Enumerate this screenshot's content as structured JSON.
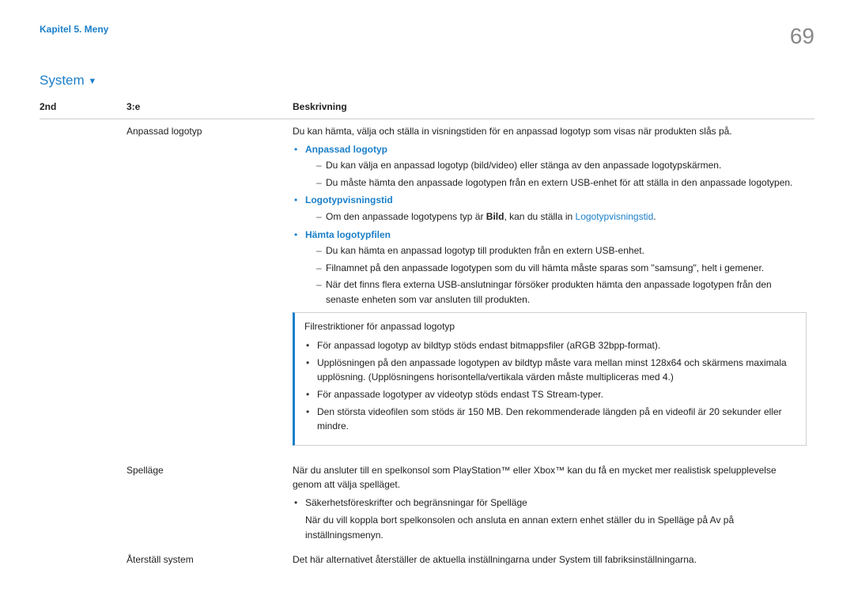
{
  "header": {
    "chapter": "Kapitel 5. Meny",
    "page_number": "69"
  },
  "section": {
    "title": "System",
    "triangle": "▼"
  },
  "columns": {
    "c1": "2nd",
    "c2": "3:e",
    "c3": "Beskrivning"
  },
  "rows": {
    "custom_logo": {
      "name": "Anpassad logotyp",
      "desc_intro": "Du kan hämta, välja och ställa in visningstiden för en anpassad logotyp som visas när produkten slås på.",
      "items": {
        "anpassad_logotyp": {
          "label": "Anpassad logotyp",
          "d1": "Du kan välja en anpassad logotyp (bild/video) eller stänga av den anpassade logotypskärmen.",
          "d2": "Du måste hämta den anpassade logotypen från en extern USB-enhet för att ställa in den anpassade logotypen."
        },
        "logotypvisningstid": {
          "label": "Logotypvisningstid",
          "d1_pre": "Om den anpassade logotypens typ är ",
          "d1_bold": "Bild",
          "d1_mid": ", kan du ställa in ",
          "d1_link": "Logotypvisningstid",
          "d1_post": "."
        },
        "hamta": {
          "label": "Hämta logotypfilen",
          "d1": "Du kan hämta en anpassad logotyp till produkten från en extern USB-enhet.",
          "d2": "Filnamnet på den anpassade logotypen som du vill hämta måste sparas som \"samsung\", helt i gemener.",
          "d3": "När det finns flera externa USB-anslutningar försöker produkten hämta den anpassade logotypen från den senaste enheten som var ansluten till produkten."
        }
      },
      "callout": {
        "title": "Filrestriktioner för anpassad logotyp",
        "b1": "För anpassad logotyp av bildtyp stöds endast bitmappsfiler (aRGB 32bpp-format).",
        "b2": "Upplösningen på den anpassade logotypen av bildtyp måste vara mellan minst 128x64 och skärmens maximala upplösning. (Upplösningens horisontella/vertikala värden måste multipliceras med 4.)",
        "b3": "För anpassade logotyper av videotyp stöds endast TS Stream-typer.",
        "b4": "Den största videofilen som stöds är 150 MB. Den rekommenderade längden på en videofil är 20 sekunder eller mindre."
      }
    },
    "game_mode": {
      "name": "Spelläge",
      "desc": "När du ansluter till en spelkonsol som PlayStation™ eller Xbox™ kan du få en mycket mer realistisk spelupplevelse genom att välja spelläget.",
      "b1": "Säkerhetsföreskrifter och begränsningar för Spelläge",
      "note": "När du vill koppla bort spelkonsolen och ansluta en annan extern enhet ställer du in Spelläge på Av på inställningsmenyn."
    },
    "reset": {
      "name": "Återställ system",
      "desc": "Det här alternativet återställer de aktuella inställningarna under System till fabriksinställningarna."
    }
  }
}
